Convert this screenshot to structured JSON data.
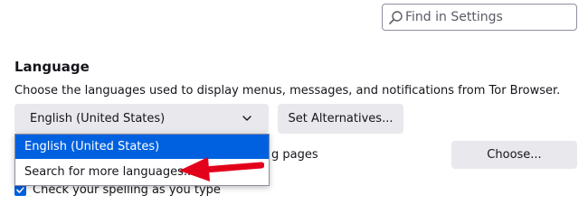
{
  "search": {
    "placeholder": "Find in Settings",
    "icon": "search-icon"
  },
  "language": {
    "heading": "Language",
    "description": "Choose the languages used to display menus, messages, and notifications from Tor Browser.",
    "select_value": "English (United States)",
    "set_alternatives_label": "Set Alternatives...",
    "dropdown_options": [
      "English (United States)",
      "Search for more languages..."
    ],
    "selected_option_index": 0
  },
  "appearance": {
    "partial_text": "g pages",
    "choose_label": "Choose..."
  },
  "spelling": {
    "checkbox_label": "Check your spelling as you type",
    "checked": true
  },
  "colors": {
    "accent": "#0061e0",
    "button_bg": "#e8e8ed",
    "annotation_arrow": "#e3001b"
  }
}
